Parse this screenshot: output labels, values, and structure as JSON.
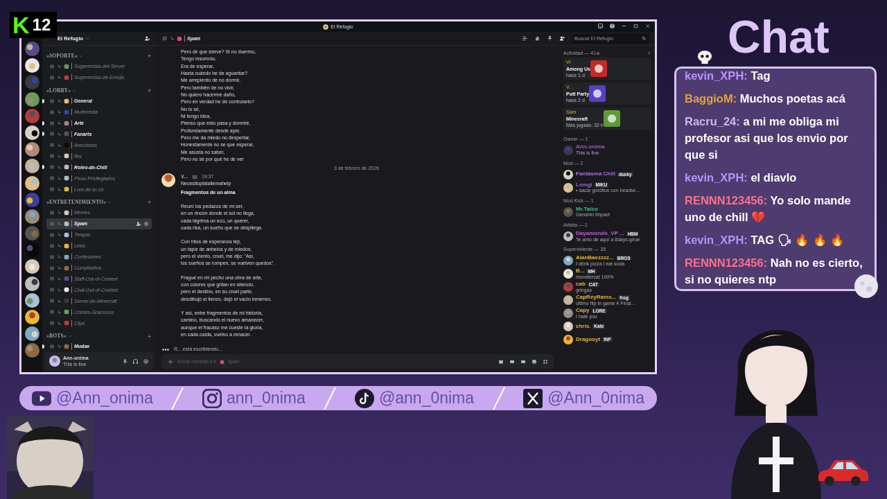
{
  "overlay": {
    "logo_letter": "K",
    "counter": "12",
    "chat_title": "Chat"
  },
  "window": {
    "title": "El Refugio"
  },
  "server": {
    "name": "El Refugio"
  },
  "categories": [
    {
      "name": "»SOPORTE«",
      "channels": [
        {
          "name": "Sugerencias-del-Server",
          "unread": false,
          "selected": false
        },
        {
          "name": "Sugerencias-de-Emojis",
          "unread": false,
          "selected": false
        }
      ]
    },
    {
      "name": "»LOBBY«",
      "channels": [
        {
          "name": "General",
          "unread": true,
          "selected": false
        },
        {
          "name": "Multimedia",
          "unread": false,
          "selected": false
        },
        {
          "name": "Arte",
          "unread": true,
          "selected": false
        },
        {
          "name": "Fanarts",
          "unread": true,
          "selected": false
        },
        {
          "name": "Anecdotas",
          "unread": false,
          "selected": false
        },
        {
          "name": "Rol",
          "unread": false,
          "selected": false
        },
        {
          "name": "Roleo-de-Chill",
          "unread": true,
          "selected": false
        },
        {
          "name": "Pisos-Privilegiados",
          "unread": false,
          "selected": false
        },
        {
          "name": "Lore-de-tu-Oc",
          "unread": false,
          "selected": false
        }
      ]
    },
    {
      "name": "»ENTRETENIMIENTO«",
      "channels": [
        {
          "name": "Memes",
          "unread": false,
          "selected": false
        },
        {
          "name": "Spam",
          "unread": false,
          "selected": true
        },
        {
          "name": "Terapia",
          "unread": false,
          "selected": false
        },
        {
          "name": "Links",
          "unread": false,
          "selected": false
        },
        {
          "name": "Confesiones",
          "unread": false,
          "selected": false
        },
        {
          "name": "Cumpleaños",
          "unread": false,
          "selected": false
        },
        {
          "name": "Staff-Out-of-Context",
          "unread": false,
          "selected": false
        },
        {
          "name": "Chat-Out-of-Context",
          "unread": false,
          "selected": false
        },
        {
          "name": "Server-de-Minecraft",
          "unread": false,
          "selected": false
        },
        {
          "name": "Chistes-Graciosos",
          "unread": false,
          "selected": false
        },
        {
          "name": "Clips",
          "unread": false,
          "selected": false
        }
      ]
    },
    {
      "name": "»BOTS«",
      "channels": [
        {
          "name": "Mudae",
          "unread": true,
          "selected": false
        }
      ]
    }
  ],
  "user_panel": {
    "name": "Ann-onima",
    "status": "This is fine"
  },
  "channel_header": {
    "name": "Spam"
  },
  "search": {
    "placeholder": "Buscar El Refugio"
  },
  "continuation": {
    "lines": [
      "Pero de que sierve? Si no duermo,",
      "Tengo insomnio,",
      "Era de esperar,",
      "Hasta cuándo he de aguantar?",
      "Me arrepiento de no dormir,",
      "Pero también de no vivir,",
      "No quiero hacerme daño,",
      "Pero en verdad he de controlarlo?",
      "No lo sé,",
      "Ni tengo idea,",
      "Pienso que esto pasa y dormiré,",
      "Profundamente desde ayer,",
      "Pero me da miedo no despertar,",
      "Honestamente no se que esperar,",
      "Me asusta no saber,",
      "Pero no sé por qué he de ver"
    ]
  },
  "date_divider": "3 de febrero de 2026",
  "message": {
    "author": "V...",
    "time": "19:37",
    "lines": [
      "Necesitoplatallemahelp"
    ],
    "title": "Fragmentos de un alma",
    "stanzas": [
      [
        "Reuní los pedazos de mi ser,",
        "en un rincón donde el sol no llega,",
        "cada lágrima un eco, un querer,",
        "cada risa, un sueño que se despliega."
      ],
      [
        "Con hilos de esperanza tejí,",
        "un tapiz de anhelos y de miedos,",
        "pero el viento, cruel, me dijo: \"Así,",
        "los sueños se rompen, se vuelven quedos\"."
      ],
      [
        "Fragué en mi pecho una obra de arte,",
        "con colores que gritan en silencio,",
        "pero el destino, en su cruel parte,",
        "desdibujó el lienzo, dejó el vacío inmenso."
      ],
      [
        "Y así, entre fragmentos de mi historia,",
        "camino, buscando el nuevo amanecer,",
        "aunque el fracaso me cueste la gloria,",
        "en cada caída, vuelvo a renacer."
      ]
    ]
  },
  "typing": "R... está escribiendo...",
  "composer": {
    "placeholder": "Enviar mensaje a #",
    "channel": "Spam"
  },
  "activity": {
    "title": "Actividad — 41",
    "cards": [
      {
        "user": "VI",
        "game": "Among Us",
        "detail": "hace 1 d"
      },
      {
        "user": "V...",
        "game": "Putt Party",
        "detail": "hace 2 d"
      },
      {
        "user": "Sam",
        "game": "Minecraft",
        "detail": "Más jugado: 32 h"
      }
    ]
  },
  "member_groups": [
    {
      "title": "Owner — 1",
      "members": [
        {
          "name": "Ann-onima",
          "color": "#8e5bd8",
          "status": "This is fine"
        }
      ]
    },
    {
      "title": "Mod — 2",
      "members": [
        {
          "name": "Fantasma Chill",
          "color": "#a36ee0",
          "tag": "dusky"
        },
        {
          "name": "Lemgi",
          "color": "#9a63d8",
          "tag": "MIKU",
          "status": "• sacar gorditos con headse..."
        }
      ]
    },
    {
      "title": "Mod Kick — 1",
      "members": [
        {
          "name": "Mr.Talco",
          "color": "#3fbf7f",
          "status": "Genshin Impact"
        }
      ]
    },
    {
      "title": "Artista — 1",
      "members": [
        {
          "name": "Dayamondo_VP ...",
          "color": "#c05ce0",
          "tag": "HBM",
          "status": "Te amo de aquí a 8days-ginar"
        }
      ]
    },
    {
      "title": "Superviviente — 35",
      "members": [
        {
          "name": "AlanBaezzzz...",
          "color": "#e3b23c",
          "tag": "BROS",
          "status": "I drink pizza I eat soda"
        },
        {
          "name": "B...",
          "color": "#e3b23c",
          "tag": "MH",
          "status": "monstercat 100%"
        },
        {
          "name": "cab",
          "color": "#e3b23c",
          "tag": "CAT",
          "status": "gringas"
        },
        {
          "name": "CapReyRams...",
          "color": "#e3b23c",
          "tag": "frog",
          "status": "último flip in game 4 Final..."
        },
        {
          "name": "Capy",
          "color": "#e3b23c",
          "tag": "LORE",
          "status": "I hate you"
        },
        {
          "name": "chris.",
          "color": "#e3b23c",
          "tag": "Kate"
        },
        {
          "name": "Dragooyt",
          "color": "#e3b23c",
          "tag": "INF"
        }
      ]
    }
  ],
  "chat": [
    {
      "user": "kevin_XPH:",
      "color": "#b594ff",
      "text": "Tag"
    },
    {
      "user": "BaggioM:",
      "color": "#e2a23a",
      "text": "Muchos poetas acá"
    },
    {
      "user": "Racru_24:",
      "color": "#cbb8ea",
      "text": "a mi me obliga mi profesor asi que los envio por que si"
    },
    {
      "user": "kevin_XPH:",
      "color": "#b594ff",
      "text": "el diavlo"
    },
    {
      "user": "RENNN123456:",
      "color": "#ff6f8c",
      "text": "Yo solo mande uno de chill 💔"
    },
    {
      "user": "kevin_XPH:",
      "color": "#b594ff",
      "text": "TAG 🗣 🔥 🔥 🔥"
    },
    {
      "user": "RENNN123456:",
      "color": "#ff6f8c",
      "text": "Nah no es cierto, si no quieres ntp"
    }
  ],
  "socials": [
    {
      "kind": "youtube",
      "handle": "@Ann_onima"
    },
    {
      "kind": "instagram",
      "handle": "ann_0nima"
    },
    {
      "kind": "tiktok",
      "handle": "@ann_0nima"
    },
    {
      "kind": "x",
      "handle": "@Ann_0nima"
    }
  ]
}
